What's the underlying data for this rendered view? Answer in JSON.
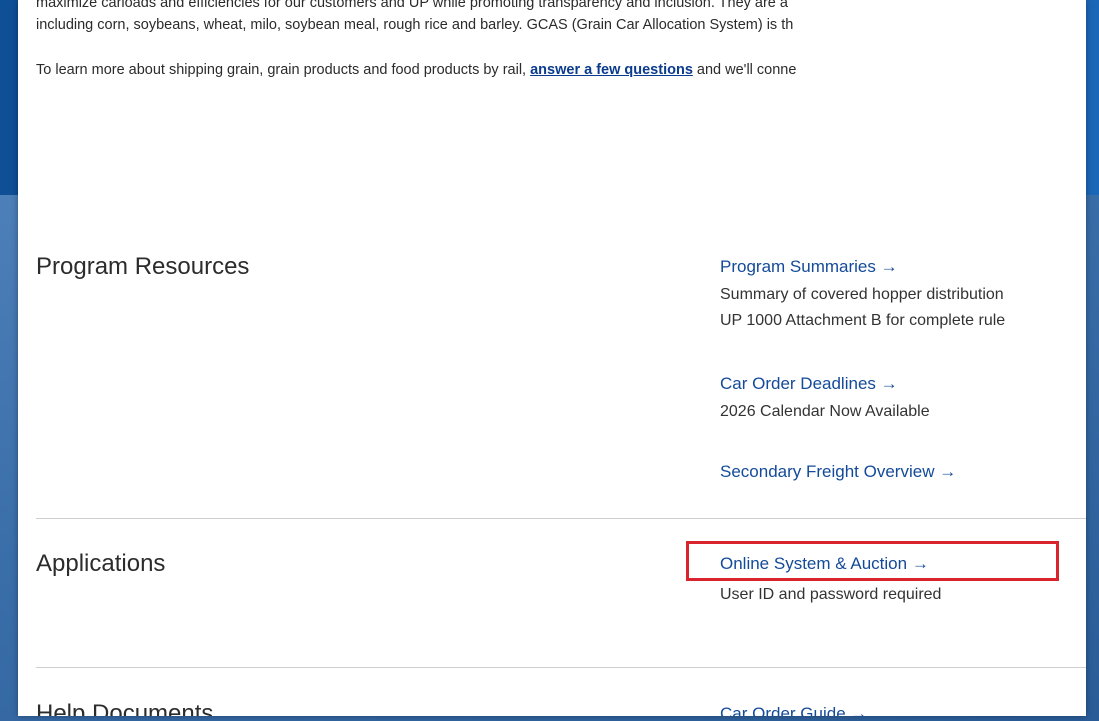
{
  "intro": {
    "line1": "maximize carloads and efficiencies for our customers and UP while promoting transparency and inclusion. They are a",
    "line2": "including corn, soybeans, wheat, milo, soybean meal, rough rice and barley. GCAS (Grain Car Allocation System) is th",
    "line3_prefix": "To learn more about shipping grain, grain products and food products by rail, ",
    "line3_link": "answer a few questions",
    "line3_suffix": " and we'll conne"
  },
  "sections": {
    "program_resources": {
      "title": "Program Resources",
      "links": [
        {
          "label": "Program Summaries →",
          "desc": [
            "Summary of covered hopper distribution",
            "UP 1000 Attachment B for complete rule"
          ]
        },
        {
          "label": "Car Order Deadlines →",
          "desc": [
            "2026 Calendar Now Available"
          ]
        },
        {
          "label": "Secondary Freight Overview →"
        }
      ]
    },
    "applications": {
      "title": "Applications",
      "links": [
        {
          "label": "Online System & Auction →",
          "desc": [
            "User ID and password required"
          ]
        }
      ]
    },
    "help_documents": {
      "title": "Help Documents",
      "links": [
        {
          "label": "Car Order Guide →"
        }
      ]
    }
  },
  "colors": {
    "link": "#134a99",
    "highlight": "#d9232d"
  }
}
